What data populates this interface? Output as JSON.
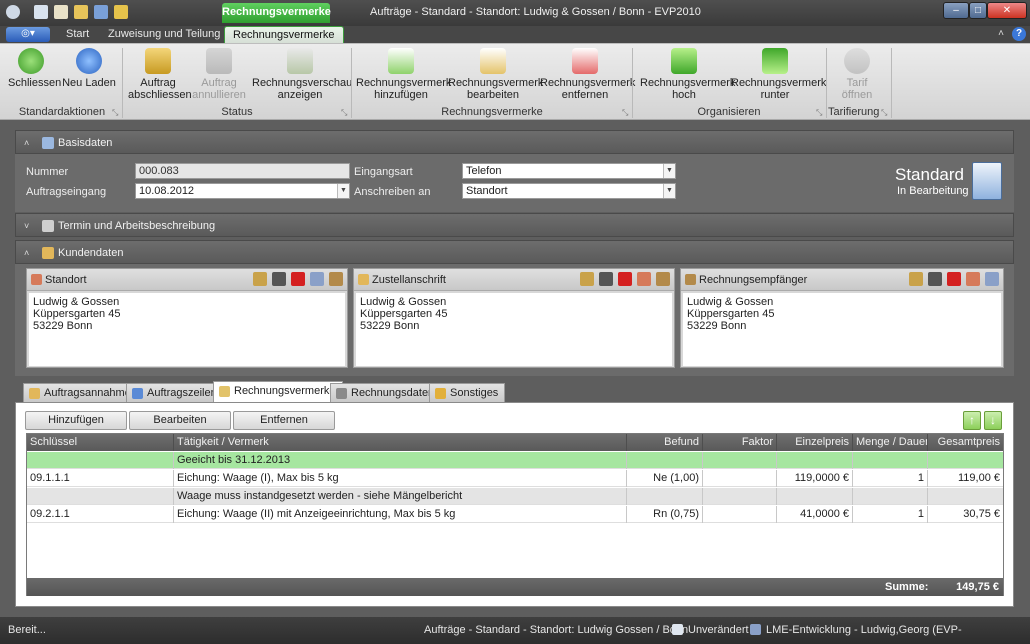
{
  "app": {
    "title": "Aufträge - Standard - Standort: Ludwig & Gossen / Bonn - EVP2010",
    "context_tab": "Rechnungsvermerke"
  },
  "ribbon_tabs": [
    "Start",
    "Zuweisung und Teilung",
    "Rechnungsvermerke"
  ],
  "ribbon": {
    "schliessen": "Schliessen",
    "neu_laden": "Neu Laden",
    "auftrag_abschliessen": [
      "Auftrag",
      "abschliessen"
    ],
    "auftrag_annullieren": [
      "Auftrag",
      "annullieren"
    ],
    "rv_anzeigen": [
      "Rechnungsverschau",
      "anzeigen"
    ],
    "rv_hinzufuegen": [
      "Rechnungsvermerk",
      "hinzufügen"
    ],
    "rv_bearbeiten": [
      "Rechnungsvermerk",
      "bearbeiten"
    ],
    "rv_entfernen": [
      "Rechnungsvermerk",
      "entfernen"
    ],
    "rv_hoch": [
      "Rechnungsvermerk",
      "hoch"
    ],
    "rv_runter": [
      "Rechnungsvermerk",
      "runter"
    ],
    "tarif_oeffnen": [
      "Tarif",
      "öffnen"
    ],
    "groups": [
      "Standardaktionen",
      "Status",
      "Rechnungsvermerke",
      "Organisieren",
      "Tarifierung"
    ]
  },
  "basisdaten": {
    "header": "Basisdaten",
    "nummer_label": "Nummer",
    "nummer": "000.083",
    "auftragseingang_label": "Auftragseingang",
    "auftragseingang": "10.08.2012",
    "eingangsart_label": "Eingangsart",
    "eingangsart": "Telefon",
    "anschreiben_label": "Anschreiben an",
    "anschreiben": "Standort",
    "status_title": "Standard",
    "status_sub": "In Bearbeitung"
  },
  "termin_header": "Termin und Arbeitsbeschreibung",
  "kunden": {
    "header": "Kundendaten",
    "boxes": [
      {
        "title": "Standort",
        "lines": [
          "Ludwig & Gossen",
          "Küppersgarten 45",
          "53229 Bonn"
        ]
      },
      {
        "title": "Zustellanschrift",
        "lines": [
          "Ludwig & Gossen",
          "Küppersgarten 45",
          "53229 Bonn"
        ]
      },
      {
        "title": "Rechnungsempfänger",
        "lines": [
          "Ludwig & Gossen",
          "Küppersgarten 45",
          "53229 Bonn"
        ]
      }
    ]
  },
  "bottom_tabs": [
    "Auftragsannahme",
    "Auftragszeilen",
    "Rechnungsvermerke",
    "Rechnungsdaten",
    "Sonstiges"
  ],
  "actions": {
    "hinzufuegen": "Hinzufügen",
    "bearbeiten": "Bearbeiten",
    "entfernen": "Entfernen"
  },
  "grid": {
    "columns": [
      "Schlüssel",
      "Tätigkeit / Vermerk",
      "Befund",
      "Faktor",
      "Einzelpreis",
      "Menge / Dauer",
      "Gesamtpreis"
    ],
    "rows": [
      {
        "type": "note",
        "highlight": true,
        "text": "Geeicht bis 31.12.2013"
      },
      {
        "type": "item",
        "key": "09.1.1.1",
        "desc": "Eichung: Waage (I), Max bis 5 kg",
        "befund": "Ne (1,00)",
        "faktor": "",
        "einzelpreis": "119,0000 €",
        "menge": "1",
        "gesamt": "119,00 €"
      },
      {
        "type": "note",
        "highlight": false,
        "text": "Waage muss instandgesetzt werden - siehe Mängelbericht"
      },
      {
        "type": "item",
        "key": "09.2.1.1",
        "desc": "Eichung: Waage (II) mit Anzeigeeinrichtung, Max bis 5 kg",
        "befund": "Rn (0,75)",
        "faktor": "",
        "einzelpreis": "41,0000 €",
        "menge": "1",
        "gesamt": "30,75 €"
      }
    ],
    "summe_label": "Summe:",
    "summe": "149,75 €"
  },
  "statusbar": {
    "left": "Bereit...",
    "context": "Aufträge - Standard - Standort: Ludwig  Gossen / Bonn",
    "state": "Unverändert",
    "user": "LME-Entwicklung - Ludwig,Georg (EVP-Administration)"
  },
  "colors": {
    "accent_green": "#2f9f2f",
    "row_highlight": "#a6e6a0",
    "dark_panel": "#6b6b6b"
  }
}
